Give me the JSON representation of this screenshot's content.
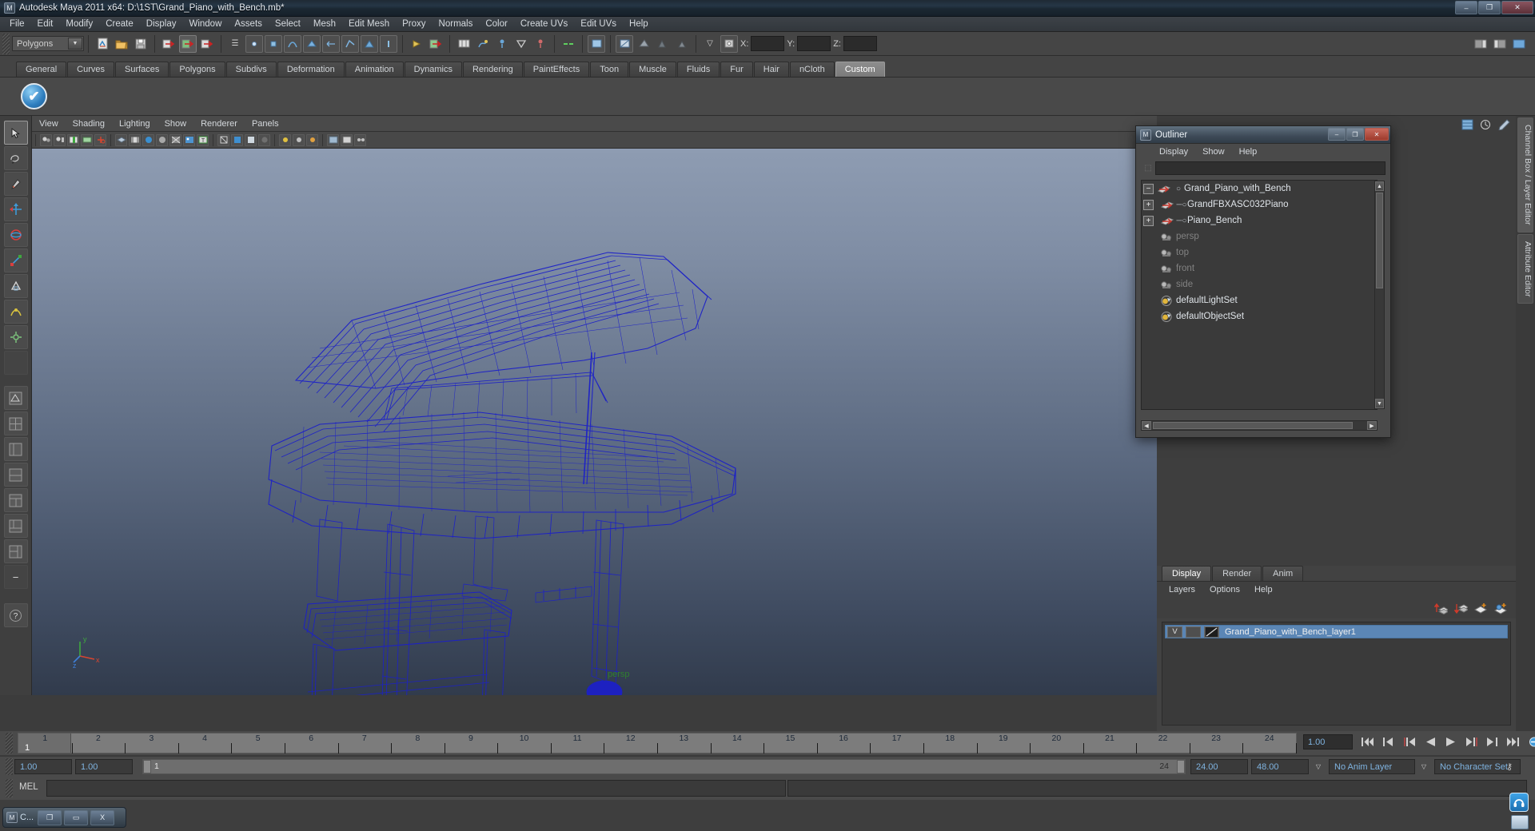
{
  "window": {
    "title": "Autodesk Maya 2011 x64: D:\\1ST\\Grand_Piano_with_Bench.mb*",
    "icon": "maya-logo-icon",
    "minimize": "–",
    "maximize": "❐",
    "close": "✕"
  },
  "menubar": {
    "items": [
      "File",
      "Edit",
      "Modify",
      "Create",
      "Display",
      "Window",
      "Assets",
      "Select",
      "Mesh",
      "Edit Mesh",
      "Proxy",
      "Normals",
      "Color",
      "Create UVs",
      "Edit UVs",
      "Help"
    ]
  },
  "statusline": {
    "mode_menu": "Polygons",
    "x_label": "X:",
    "y_label": "Y:",
    "z_label": "Z:",
    "x_value": "",
    "y_value": "",
    "z_value": ""
  },
  "shelf": {
    "tabs": [
      "General",
      "Curves",
      "Surfaces",
      "Polygons",
      "Subdivs",
      "Deformation",
      "Animation",
      "Dynamics",
      "Rendering",
      "PaintEffects",
      "Toon",
      "Muscle",
      "Fluids",
      "Fur",
      "Hair",
      "nCloth",
      "Custom"
    ],
    "active_tab": "Custom",
    "button_glyph": "✔"
  },
  "viewport": {
    "menu": [
      "View",
      "Shading",
      "Lighting",
      "Show",
      "Renderer",
      "Panels"
    ],
    "camera_label": "persp",
    "axis": {
      "y": "y",
      "x": "x",
      "z": "z"
    },
    "wire_color": "#1c20c8",
    "bg_top": "#8e9cb2",
    "bg_bottom": "#313b4c"
  },
  "outliner": {
    "title": "Outliner",
    "menu": [
      "Display",
      "Show",
      "Help"
    ],
    "search_value": "",
    "minimize": "–",
    "maximize": "❐",
    "close": "✕",
    "rows": [
      {
        "expander": "−",
        "icon": "transform-icon",
        "connector": "○",
        "label": "Grand_Piano_with_Bench",
        "indent": 0,
        "dim": false
      },
      {
        "expander": "+",
        "icon": "transform-icon",
        "connector": "─○",
        "label": "GrandFBXASC032Piano",
        "indent": 1,
        "dim": false
      },
      {
        "expander": "+",
        "icon": "transform-icon",
        "connector": "─○",
        "label": "Piano_Bench",
        "indent": 1,
        "dim": false
      },
      {
        "expander": "",
        "icon": "camera-icon",
        "connector": "",
        "label": "persp",
        "indent": 1,
        "dim": true
      },
      {
        "expander": "",
        "icon": "camera-icon",
        "connector": "",
        "label": "top",
        "indent": 1,
        "dim": true
      },
      {
        "expander": "",
        "icon": "camera-icon",
        "connector": "",
        "label": "front",
        "indent": 1,
        "dim": true
      },
      {
        "expander": "",
        "icon": "camera-icon",
        "connector": "",
        "label": "side",
        "indent": 1,
        "dim": true
      },
      {
        "expander": "",
        "icon": "set-icon",
        "connector": "",
        "label": "defaultLightSet",
        "indent": 1,
        "dim": false
      },
      {
        "expander": "",
        "icon": "set-icon",
        "connector": "",
        "label": "defaultObjectSet",
        "indent": 1,
        "dim": false
      }
    ]
  },
  "rightdock": {
    "vertical_tabs": [
      "Channel Box / Layer Editor",
      "Attribute Editor"
    ],
    "active_vertical_tab": "Channel Box / Layer Editor",
    "close_glyph": "✕"
  },
  "layereditor": {
    "tabs": [
      "Display",
      "Render",
      "Anim"
    ],
    "active_tab": "Display",
    "menu": [
      "Layers",
      "Options",
      "Help"
    ],
    "toolbar_icons": [
      "move-layer-up-icon",
      "move-layer-down-icon",
      "new-layer-icon",
      "new-layer-from-selected-icon"
    ],
    "layers": [
      {
        "visibility": "V",
        "playback": "",
        "template": "",
        "name": "Grand_Piano_with_Bench_layer1",
        "selected": true
      }
    ]
  },
  "timeslider": {
    "ticks": [
      1,
      2,
      3,
      4,
      5,
      6,
      7,
      8,
      9,
      10,
      11,
      12,
      13,
      14,
      15,
      16,
      17,
      18,
      19,
      20,
      21,
      22,
      23,
      24
    ],
    "current_frame_label": "1",
    "current_time_field": "1.00",
    "playback_buttons": [
      "go-to-start-icon",
      "step-back-key-icon",
      "step-back-frame-icon",
      "play-backwards-icon",
      "play-forwards-icon",
      "step-forward-frame-icon",
      "step-forward-key-icon",
      "go-to-end-icon"
    ]
  },
  "rangeslider": {
    "anim_start": "1.00",
    "range_start": "1.00",
    "bar_start_label": "1",
    "bar_end_label": "24",
    "range_end": "24.00",
    "anim_end": "48.00",
    "anim_layer": "No Anim Layer",
    "character_set": "No Character Set",
    "key_icon": "key-icon"
  },
  "commandline": {
    "label": "MEL",
    "input_value": "",
    "output_value": ""
  },
  "taskbar": {
    "window_label": "C...",
    "restore": "❐",
    "maximize": "▭",
    "close": "X",
    "icon": "maya-logo-icon"
  }
}
